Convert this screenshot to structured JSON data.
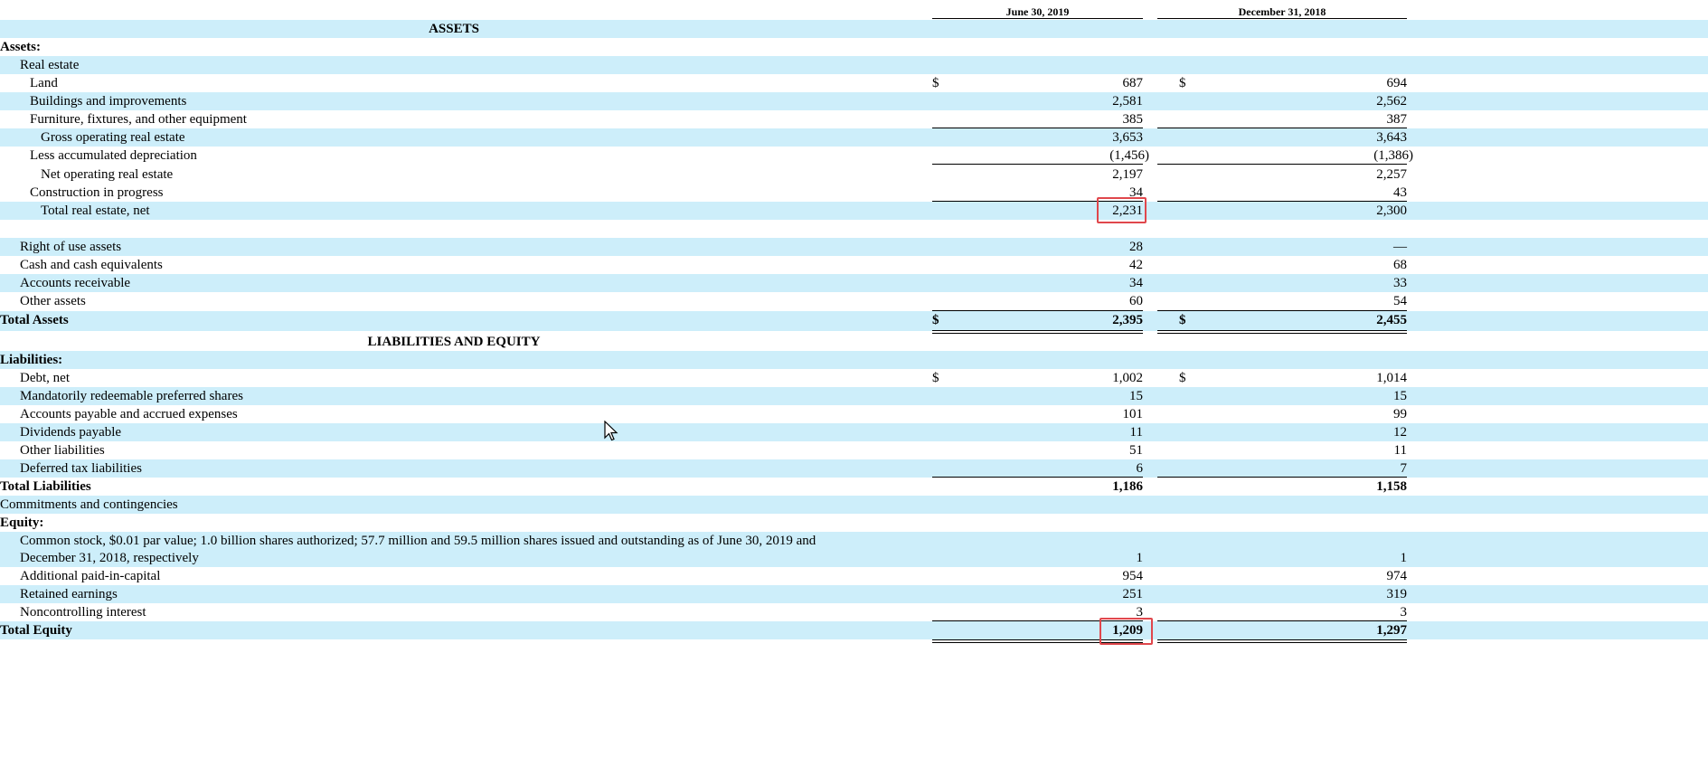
{
  "columns": [
    "June 30, 2019",
    "December 31, 2018"
  ],
  "sections": {
    "assets": "ASSETS",
    "liab_equity": "LIABILITIES AND EQUITY"
  },
  "rows": [
    {
      "label": "Assets:",
      "bold": true,
      "indent": 0,
      "v1": "",
      "v2": ""
    },
    {
      "label": "Real estate",
      "indent": 1,
      "v1": "",
      "v2": ""
    },
    {
      "label": "Land",
      "indent": 2,
      "v1": "687",
      "v2": "694",
      "dollar": true
    },
    {
      "label": "Buildings and improvements",
      "indent": 2,
      "v1": "2,581",
      "v2": "2,562"
    },
    {
      "label": "Furniture, fixtures, and other equipment",
      "indent": 2,
      "v1": "385",
      "v2": "387"
    },
    {
      "label": "Gross operating real estate",
      "indent": 3,
      "v1": "3,653",
      "v2": "3,643"
    },
    {
      "label": "Less accumulated depreciation",
      "indent": 2,
      "v1": "(1,456)",
      "v2": "(1,386)"
    },
    {
      "label": "Net operating real estate",
      "indent": 3,
      "v1": "2,197",
      "v2": "2,257"
    },
    {
      "label": "Construction in progress",
      "indent": 2,
      "v1": "34",
      "v2": "43"
    },
    {
      "label": "Total real estate, net",
      "indent": 3,
      "v1": "2,231",
      "v2": "2,300"
    },
    {
      "label": "Right of use assets",
      "indent": 1,
      "v1": "28",
      "v2": "—"
    },
    {
      "label": "Cash and cash equivalents",
      "indent": 1,
      "v1": "42",
      "v2": "68"
    },
    {
      "label": "Accounts receivable",
      "indent": 1,
      "v1": "34",
      "v2": "33"
    },
    {
      "label": "Other assets",
      "indent": 1,
      "v1": "60",
      "v2": "54"
    },
    {
      "label": "Total Assets",
      "bold": true,
      "indent": 0,
      "v1": "2,395",
      "v2": "2,455",
      "dollar": true
    },
    {
      "label": "Liabilities:",
      "bold": true,
      "indent": 0,
      "v1": "",
      "v2": ""
    },
    {
      "label": "Debt, net",
      "indent": 1,
      "v1": "1,002",
      "v2": "1,014",
      "dollar": true
    },
    {
      "label": "Mandatorily redeemable preferred shares",
      "indent": 1,
      "v1": "15",
      "v2": "15"
    },
    {
      "label": "Accounts payable and accrued expenses",
      "indent": 1,
      "v1": "101",
      "v2": "99"
    },
    {
      "label": "Dividends payable",
      "indent": 1,
      "v1": "11",
      "v2": "12"
    },
    {
      "label": "Other liabilities",
      "indent": 1,
      "v1": "51",
      "v2": "11"
    },
    {
      "label": "Deferred tax liabilities",
      "indent": 1,
      "v1": "6",
      "v2": "7"
    },
    {
      "label": "Total Liabilities",
      "bold": true,
      "indent": 0,
      "v1": "1,186",
      "v2": "1,158"
    },
    {
      "label": "Commitments and contingencies",
      "indent": 0,
      "v1": "",
      "v2": ""
    },
    {
      "label": "Equity:",
      "bold": true,
      "indent": 0,
      "v1": "",
      "v2": ""
    },
    {
      "label": "Common stock, $0.01 par value; 1.0 billion shares authorized; 57.7 million and 59.5 million shares issued and outstanding as of June 30, 2019 and",
      "label2": "December 31, 2018, respectively",
      "indent": 1,
      "v1": "1",
      "v2": "1"
    },
    {
      "label": "Additional paid-in-capital",
      "indent": 1,
      "v1": "954",
      "v2": "974"
    },
    {
      "label": "Retained earnings",
      "indent": 1,
      "v1": "251",
      "v2": "319"
    },
    {
      "label": "Noncontrolling interest",
      "indent": 1,
      "v1": "3",
      "v2": "3"
    },
    {
      "label": "Total Equity",
      "bold": true,
      "indent": 0,
      "v1": "1,209",
      "v2": "1,297"
    }
  ],
  "dollar_sign": "$"
}
